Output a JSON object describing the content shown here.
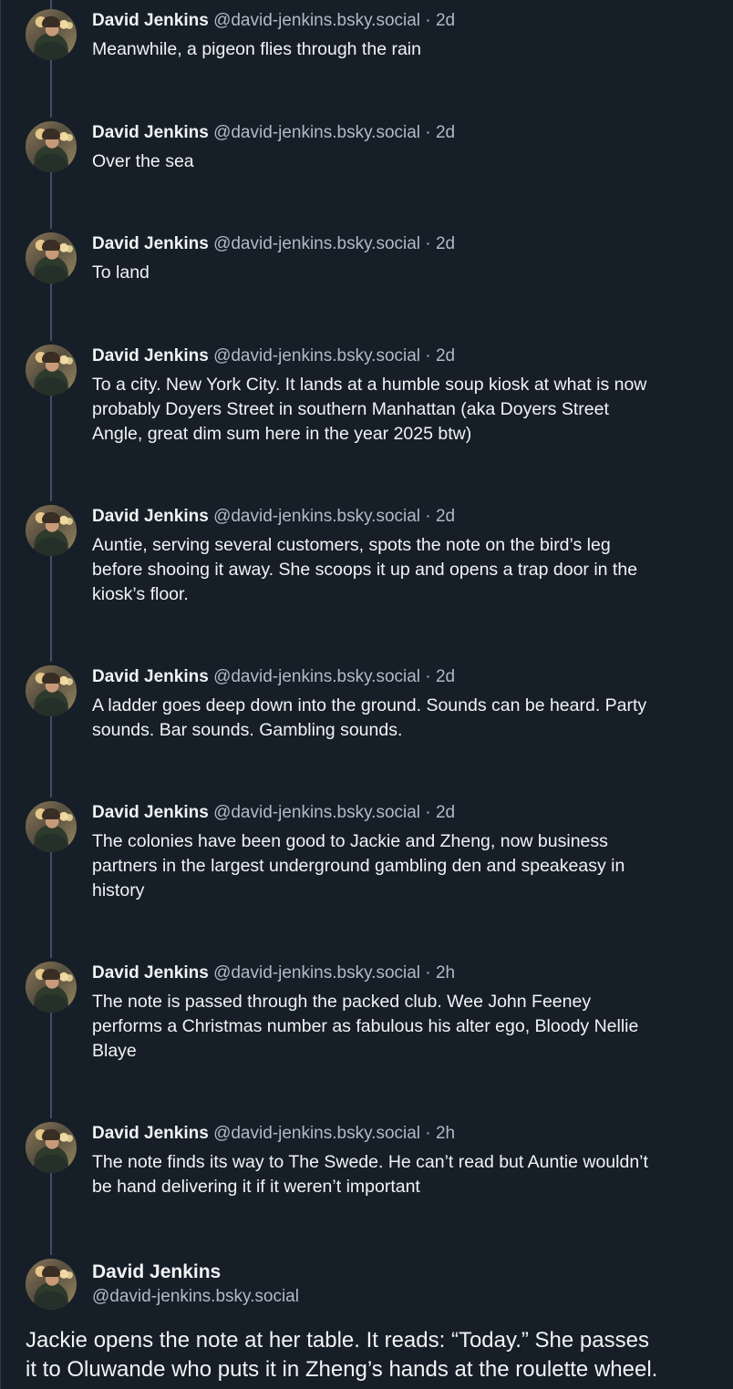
{
  "thread": {
    "posts": [
      {
        "author": "David Jenkins",
        "handle": "@david-jenkins.bsky.social",
        "separator": "·",
        "time": "2d",
        "text": "Meanwhile, a pigeon flies through the rain"
      },
      {
        "author": "David Jenkins",
        "handle": "@david-jenkins.bsky.social",
        "separator": "·",
        "time": "2d",
        "text": "Over the sea"
      },
      {
        "author": "David Jenkins",
        "handle": "@david-jenkins.bsky.social",
        "separator": "·",
        "time": "2d",
        "text": "To land"
      },
      {
        "author": "David Jenkins",
        "handle": "@david-jenkins.bsky.social",
        "separator": "·",
        "time": "2d",
        "text": "To a city. New York City. It lands at a humble soup kiosk at what is now\nprobably Doyers Street in southern Manhattan (aka Doyers Street\nAngle, great dim sum here in the year 2025 btw)"
      },
      {
        "author": "David Jenkins",
        "handle": "@david-jenkins.bsky.social",
        "separator": "·",
        "time": "2d",
        "text": "Auntie, serving several customers, spots the note on the bird’s leg\nbefore shooing it away. She scoops it up and opens a trap door in the\nkiosk’s floor."
      },
      {
        "author": "David Jenkins",
        "handle": "@david-jenkins.bsky.social",
        "separator": "·",
        "time": "2d",
        "text": "A ladder goes deep down into the ground. Sounds can be heard. Party\nsounds. Bar sounds. Gambling sounds."
      },
      {
        "author": "David Jenkins",
        "handle": "@david-jenkins.bsky.social",
        "separator": "·",
        "time": "2d",
        "text": "The colonies have been good to Jackie and Zheng, now business\npartners in the largest underground gambling den and speakeasy in\nhistory"
      },
      {
        "author": "David Jenkins",
        "handle": "@david-jenkins.bsky.social",
        "separator": "·",
        "time": "2h",
        "text": "The note is passed through the packed club. Wee John Feeney\nperforms a Christmas number as fabulous his alter ego, Bloody Nellie\nBlaye"
      },
      {
        "author": "David Jenkins",
        "handle": "@david-jenkins.bsky.social",
        "separator": "·",
        "time": "2h",
        "text": "The note finds its way to The Swede. He can’t read but Auntie wouldn’t\nbe hand delivering it if it weren’t important"
      }
    ],
    "main_post": {
      "author": "David Jenkins",
      "handle": "@david-jenkins.bsky.social",
      "text": "Jackie opens the note at her table. It reads: “Today.” She passes\nit to Oluwande who puts it in Zheng’s hands at the roulette wheel."
    }
  }
}
